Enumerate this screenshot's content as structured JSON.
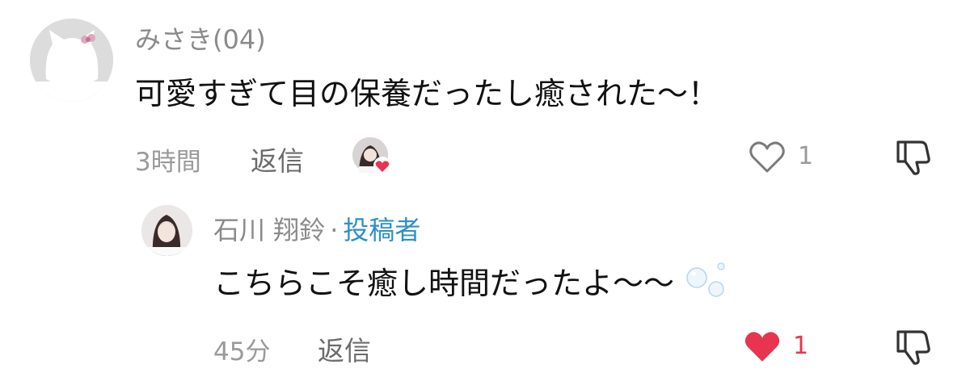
{
  "comment": {
    "username": "みさき(04)",
    "text": "可愛すぎて目の保養だったし癒された〜！",
    "time": "3時間",
    "reply_label": "返信",
    "like_count": "1",
    "liked": false
  },
  "reply": {
    "username": "石川 翔鈴",
    "separator": "·",
    "author_badge": "投稿者",
    "text": "こちらこそ癒し時間だったよ〜〜",
    "time": "45分",
    "reply_label": "返信",
    "like_count": "1",
    "liked": true
  },
  "colors": {
    "accent_blue": "#2f8fc6",
    "heart_red": "#e8344e",
    "muted_gray": "#9a9a9a"
  }
}
